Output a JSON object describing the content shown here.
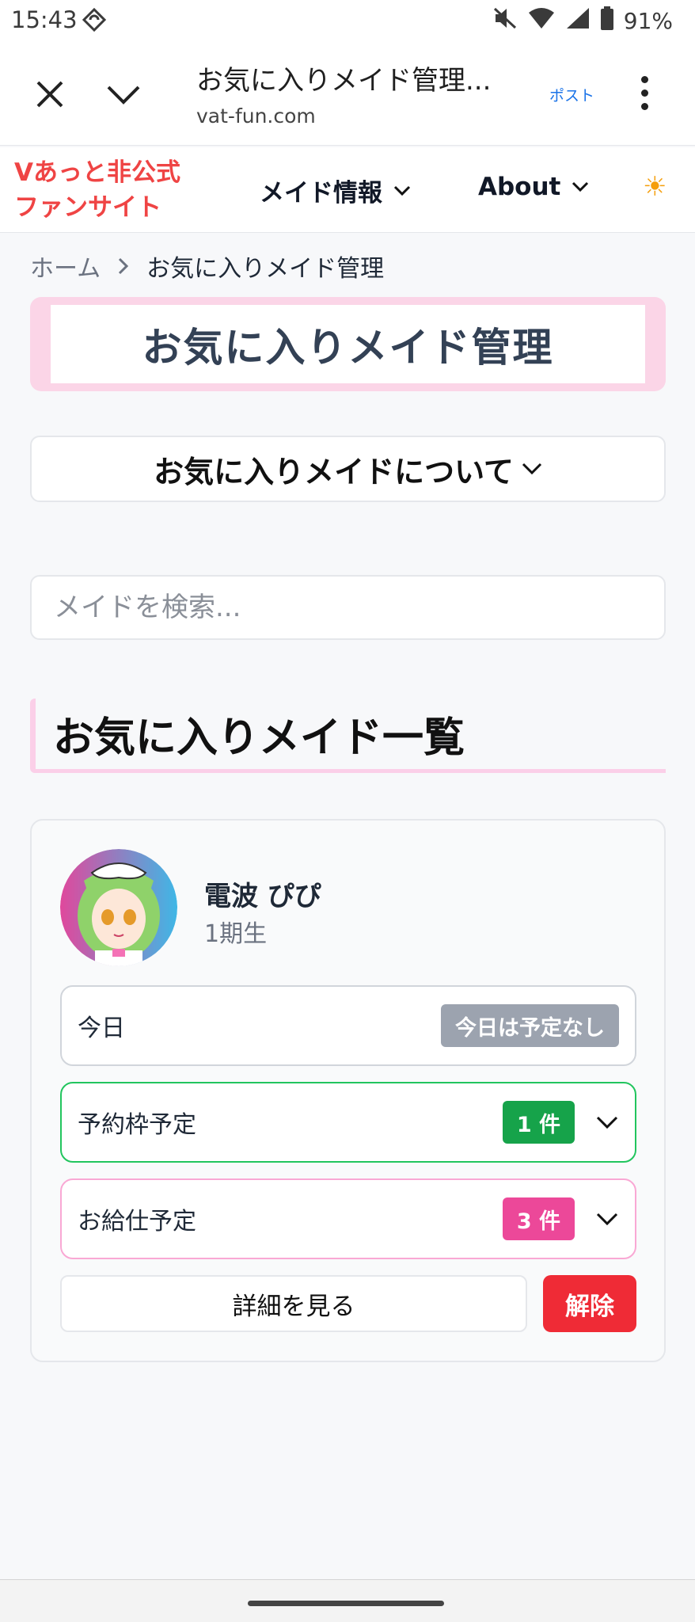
{
  "status_bar": {
    "time": "15:43",
    "battery": "91%"
  },
  "browser": {
    "page_title": "お気に入りメイド管理...",
    "url": "vat-fun.com",
    "post_label": "ポスト"
  },
  "site": {
    "logo_line1": "Vあっと非公式",
    "logo_line2": "ファンサイト",
    "nav": [
      {
        "label": "メイド情報"
      },
      {
        "label": "About"
      }
    ]
  },
  "breadcrumb": {
    "home": "ホーム",
    "current": "お気に入りメイド管理"
  },
  "page": {
    "title": "お気に入りメイド管理",
    "about_accordion": "お気に入りメイドについて",
    "search_placeholder": "メイドを検索...",
    "section_title": "お気に入りメイド一覧"
  },
  "maid": {
    "name": "電波 ぴぴ",
    "generation": "1期生",
    "today_label": "今日",
    "today_badge": "今日は予定なし",
    "reserve_label": "予約枠予定",
    "reserve_badge": "1 件",
    "serve_label": "お給仕予定",
    "serve_badge": "3 件",
    "detail_button": "詳細を見る",
    "remove_button": "解除"
  },
  "colors": {
    "logo": "#ef4444",
    "pink_accent": "#fbcfe8",
    "reserve": "#16a34a",
    "serve": "#ec4899",
    "remove": "#ef2b36",
    "today_badge": "#9ca3af"
  }
}
